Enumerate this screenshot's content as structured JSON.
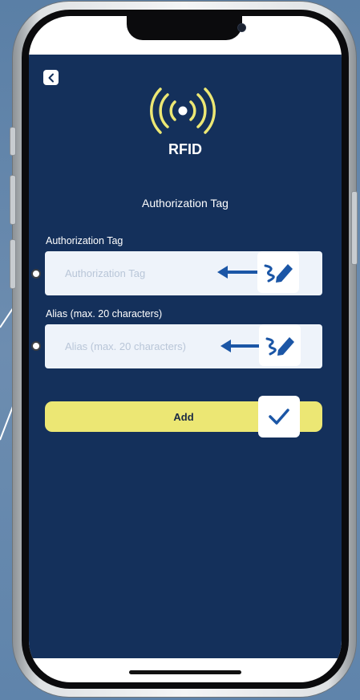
{
  "header": {
    "title": "RFID",
    "icon": "rfid-signal-icon"
  },
  "back": {
    "icon": "chevron-left-icon"
  },
  "section_title": "Authorization Tag",
  "form": {
    "tag": {
      "label": "Authorization Tag",
      "placeholder": "Authorization Tag",
      "value": ""
    },
    "alias": {
      "label": "Alias (max. 20 characters)",
      "placeholder": "Alias (max. 20 characters)",
      "value": ""
    },
    "add_label": "Add"
  },
  "overlays": {
    "edit_icon": "signature-pen-icon",
    "confirm_icon": "checkmark-icon",
    "arrow_icon": "arrow-left-icon"
  },
  "colors": {
    "app_background": "#14305b",
    "accent_yellow": "#ece774",
    "icon_blue": "#1b56a6",
    "input_background": "#eef3fa"
  }
}
